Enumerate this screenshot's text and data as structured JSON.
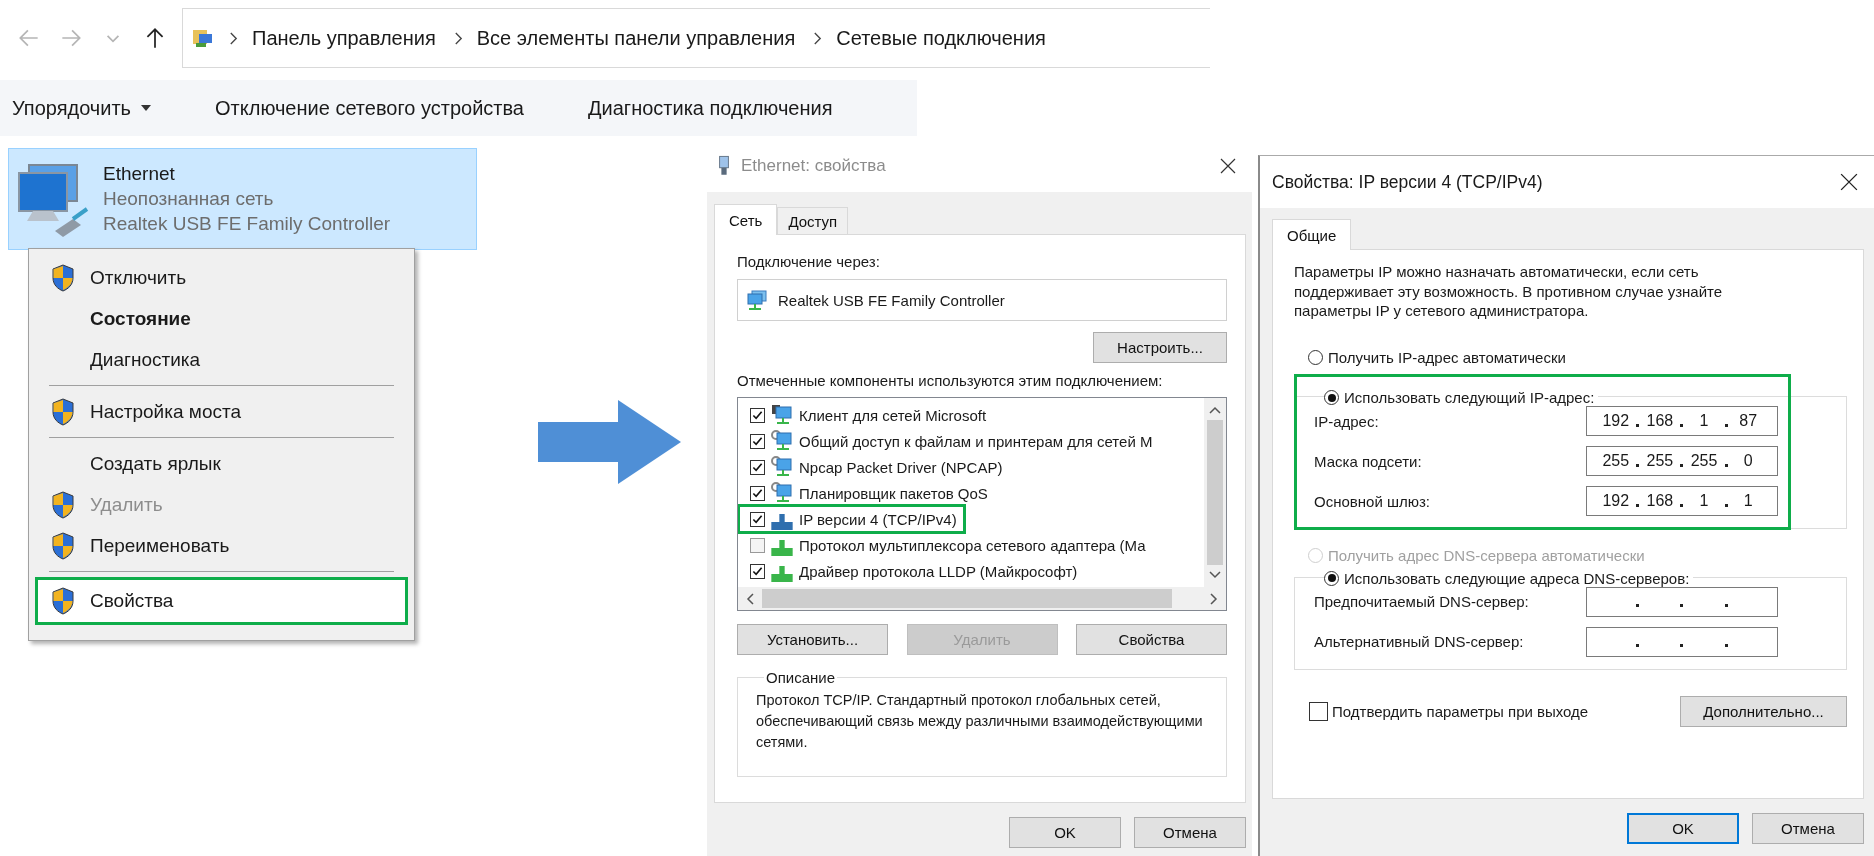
{
  "explorer": {
    "nav_buttons": [
      {
        "kind": "back",
        "disabled": true
      },
      {
        "kind": "forward",
        "disabled": true
      },
      {
        "kind": "recent",
        "disabled": true
      },
      {
        "kind": "up",
        "disabled": false
      }
    ],
    "breadcrumb": [
      "Панель управления",
      "Все элементы панели управления",
      "Сетевые подключения"
    ],
    "toolbar": [
      {
        "label": "Упорядочить",
        "dropdown": true
      },
      {
        "label": "Отключение сетевого устройства",
        "dropdown": false
      },
      {
        "label": "Диагностика подключения",
        "dropdown": false
      }
    ],
    "connection": {
      "name": "Ethernet",
      "status": "Неопознанная сеть",
      "device": "Realtek USB FE Family Controller",
      "selected": true
    }
  },
  "context_menu": [
    {
      "kind": "item",
      "label": "Отключить",
      "shield": true,
      "bold": false,
      "disabled": false,
      "highlighted": false
    },
    {
      "kind": "item",
      "label": "Состояние",
      "shield": false,
      "bold": true,
      "disabled": false,
      "highlighted": false
    },
    {
      "kind": "item",
      "label": "Диагностика",
      "shield": false,
      "bold": false,
      "disabled": false,
      "highlighted": false
    },
    {
      "kind": "separator"
    },
    {
      "kind": "item",
      "label": "Настройка моста",
      "shield": true,
      "bold": false,
      "disabled": false,
      "highlighted": false
    },
    {
      "kind": "separator"
    },
    {
      "kind": "item",
      "label": "Создать ярлык",
      "shield": false,
      "bold": false,
      "disabled": false,
      "highlighted": false
    },
    {
      "kind": "item",
      "label": "Удалить",
      "shield": true,
      "bold": false,
      "disabled": true,
      "highlighted": false
    },
    {
      "kind": "item",
      "label": "Переименовать",
      "shield": true,
      "bold": false,
      "disabled": false,
      "highlighted": false
    },
    {
      "kind": "separator"
    },
    {
      "kind": "item",
      "label": "Свойства",
      "shield": true,
      "bold": false,
      "disabled": false,
      "highlighted": true
    }
  ],
  "ethernet_dialog": {
    "title": "Ethernet: свойства",
    "active": false,
    "tabs": [
      {
        "label": "Сеть",
        "selected": true
      },
      {
        "label": "Доступ",
        "selected": false
      }
    ],
    "connect_using_label": "Подключение через:",
    "adapter": "Realtek USB FE Family Controller",
    "configure_button": "Настроить...",
    "components_label": "Отмеченные компоненты используются этим подключением:",
    "components": [
      {
        "kind": "client",
        "label": "Клиент для сетей Microsoft",
        "checked": true,
        "highlighted": false
      },
      {
        "kind": "service",
        "label": "Общий доступ к файлам и принтерам для сетей M",
        "checked": true,
        "highlighted": false
      },
      {
        "kind": "service",
        "label": "Npcap Packet Driver (NPCAP)",
        "checked": true,
        "highlighted": false
      },
      {
        "kind": "service",
        "label": "Планировщик пакетов QoS",
        "checked": true,
        "highlighted": false
      },
      {
        "kind": "protocol",
        "label": "IP версии 4 (TCP/IPv4)",
        "checked": true,
        "highlighted": true
      },
      {
        "kind": "protocol",
        "label": "Протокол мультиплексора сетевого адаптера (Ма",
        "checked": false,
        "highlighted": false
      },
      {
        "kind": "protocol",
        "label": "Драйвер протокола LLDP (Майкрософт)",
        "checked": true,
        "highlighted": false
      }
    ],
    "buttons": [
      {
        "label": "Установить...",
        "disabled": false
      },
      {
        "label": "Удалить",
        "disabled": true
      },
      {
        "label": "Свойства",
        "disabled": false
      }
    ],
    "description": {
      "legend": "Описание",
      "text": "Протокол TCP/IP. Стандартный протокол глобальных сетей, обеспечивающий связь между различными взаимодействующими сетями."
    },
    "footer_buttons": [
      {
        "label": "OK",
        "default": false
      },
      {
        "label": "Отмена",
        "default": false
      }
    ]
  },
  "ipv4_dialog": {
    "title": "Свойства: IP версии 4 (TCP/IPv4)",
    "active": true,
    "tabs": [
      {
        "label": "Общие",
        "selected": true
      }
    ],
    "intro": "Параметры IP можно назначать автоматически, если сеть поддерживает эту возможность. В противном случае узнайте параметры IP у сетевого администратора.",
    "ip_mode": [
      {
        "label": "Получить IP-адрес автоматически",
        "selected": false,
        "disabled": false
      },
      {
        "label": "Использовать следующий IP-адрес:",
        "selected": true,
        "disabled": false
      }
    ],
    "ip_highlighted": true,
    "ip_fields": [
      {
        "label": "IP-адрес:",
        "octets": [
          "192",
          "168",
          "1",
          "87"
        ]
      },
      {
        "label": "Маска подсети:",
        "octets": [
          "255",
          "255",
          "255",
          "0"
        ]
      },
      {
        "label": "Основной шлюз:",
        "octets": [
          "192",
          "168",
          "1",
          "1"
        ]
      }
    ],
    "dns_mode": [
      {
        "label": "Получить адрес DNS-сервера автоматически",
        "selected": false,
        "disabled": true
      },
      {
        "label": "Использовать следующие адреса DNS-серверов:",
        "selected": true,
        "disabled": false
      }
    ],
    "dns_fields": [
      {
        "label": "Предпочитаемый DNS-сервер:"
      },
      {
        "label": "Альтернативный DNS-сервер:"
      }
    ],
    "validate": {
      "label": "Подтвердить параметры при выходе",
      "checked": false
    },
    "advanced_button": "Дополнительно...",
    "footer_buttons": [
      {
        "label": "OK",
        "default": true
      },
      {
        "label": "Отмена",
        "default": false
      }
    ]
  }
}
